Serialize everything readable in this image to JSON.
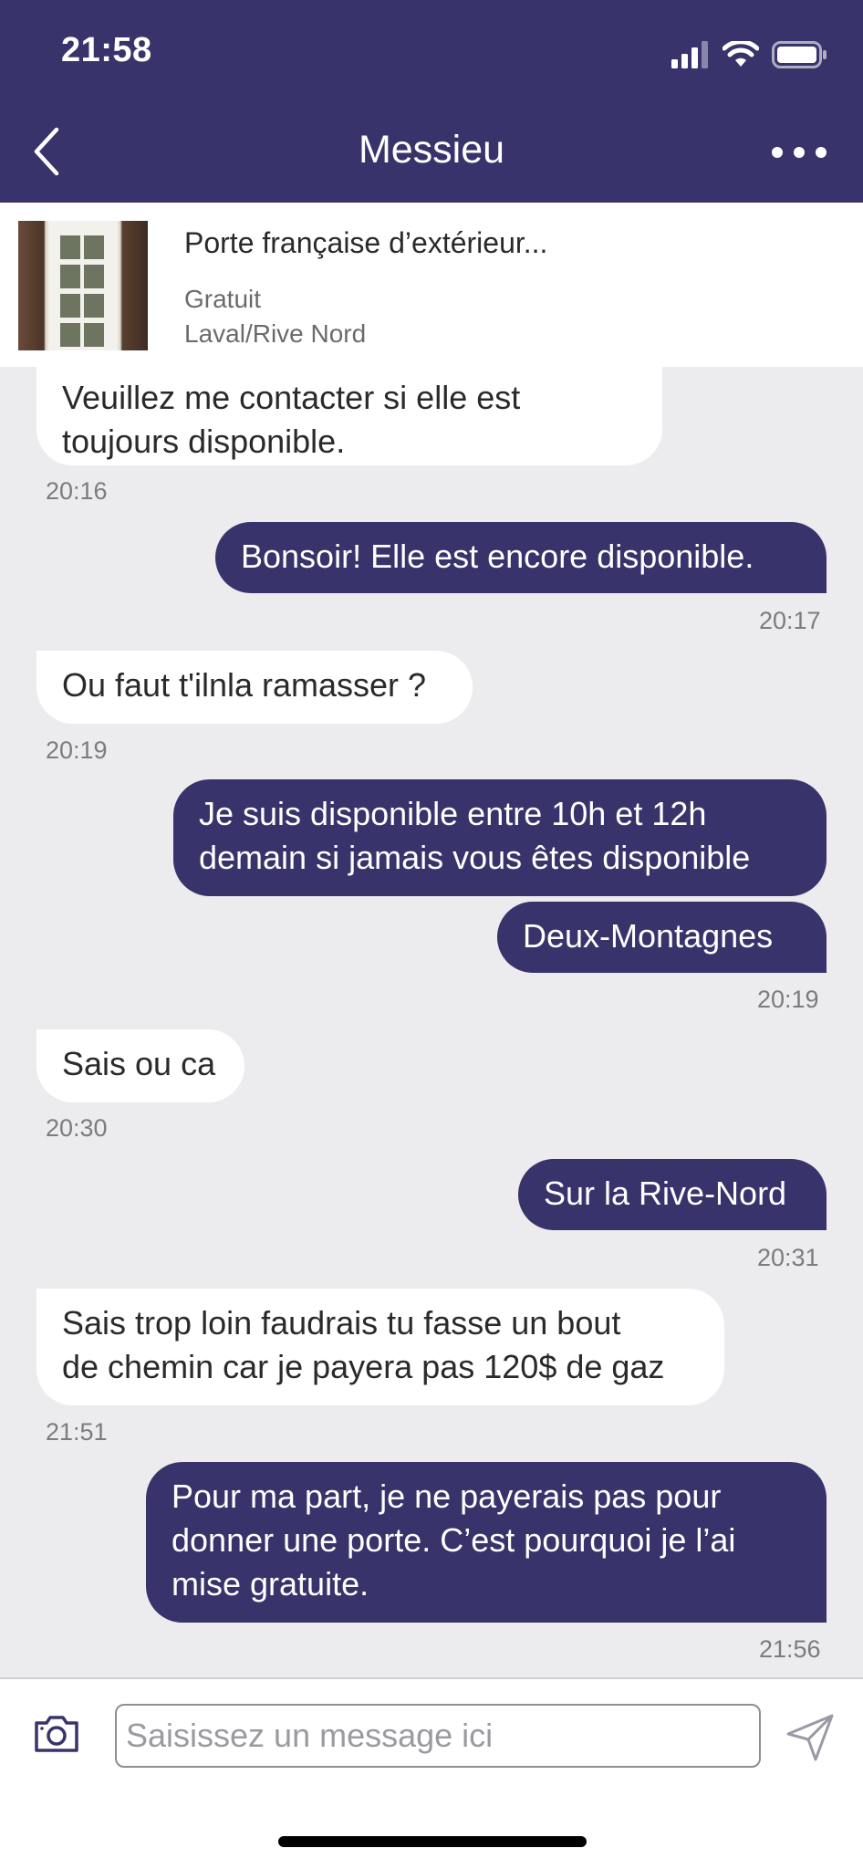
{
  "status": {
    "time": "21:58"
  },
  "header": {
    "title": "Messieu"
  },
  "listing": {
    "title": "Porte française d’extérieur...",
    "price": "Gratuit",
    "location": "Laval/Rive Nord"
  },
  "messages": [
    {
      "dir": "in",
      "lines": [
        "Veuillez me contacter si elle est",
        "toujours disponible."
      ],
      "time": "20:16"
    },
    {
      "dir": "out",
      "lines": [
        "Bonsoir! Elle est encore disponible."
      ],
      "time": "20:17"
    },
    {
      "dir": "in",
      "lines": [
        "Ou faut t'ilnla ramasser ?"
      ],
      "time": "20:19"
    },
    {
      "dir": "out",
      "lines": [
        "Je suis disponible entre 10h et 12h",
        "demain si jamais vous êtes disponible"
      ],
      "time": ""
    },
    {
      "dir": "out",
      "lines": [
        "Deux-Montagnes"
      ],
      "time": "20:19"
    },
    {
      "dir": "in",
      "lines": [
        "Sais ou ca"
      ],
      "time": "20:30"
    },
    {
      "dir": "out",
      "lines": [
        "Sur la Rive-Nord"
      ],
      "time": "20:31"
    },
    {
      "dir": "in",
      "lines": [
        "Sais trop loin faudrais tu fasse un bout",
        "de chemin car je payera pas 120$ de gaz"
      ],
      "time": "21:51"
    },
    {
      "dir": "out",
      "lines": [
        "Pour ma part, je ne payerais pas pour",
        "donner une porte. C’est pourquoi je l’ai",
        "mise gratuite."
      ],
      "time": "21:56"
    }
  ],
  "composer": {
    "placeholder": "Saisissez un message ici"
  },
  "colors": {
    "header": "#38336A",
    "outgoing_bubble": "#38336A",
    "incoming_bubble": "#FFFFFF",
    "chat_bg": "#ECECEF"
  }
}
